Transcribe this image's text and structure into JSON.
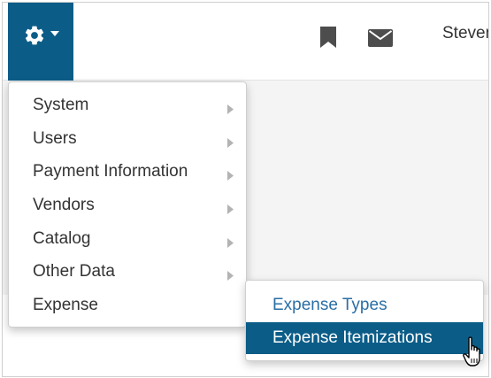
{
  "header": {
    "username": "Steven",
    "icons": [
      "gear-icon",
      "caret-down-icon",
      "bookmark-icon",
      "envelope-icon"
    ]
  },
  "menu": {
    "items": [
      {
        "label": "System",
        "has_submenu": true
      },
      {
        "label": "Users",
        "has_submenu": true
      },
      {
        "label": "Payment Information",
        "has_submenu": true
      },
      {
        "label": "Vendors",
        "has_submenu": true
      },
      {
        "label": "Catalog",
        "has_submenu": true
      },
      {
        "label": "Other Data",
        "has_submenu": true
      },
      {
        "label": "Expense",
        "has_submenu": false
      }
    ]
  },
  "submenu": {
    "items": [
      {
        "label": "Expense Types",
        "highlighted": false
      },
      {
        "label": "Expense Itemizations",
        "highlighted": true
      }
    ]
  },
  "colors": {
    "accent": "#0b5d88",
    "link": "#2a6fa5",
    "text": "#333333"
  }
}
